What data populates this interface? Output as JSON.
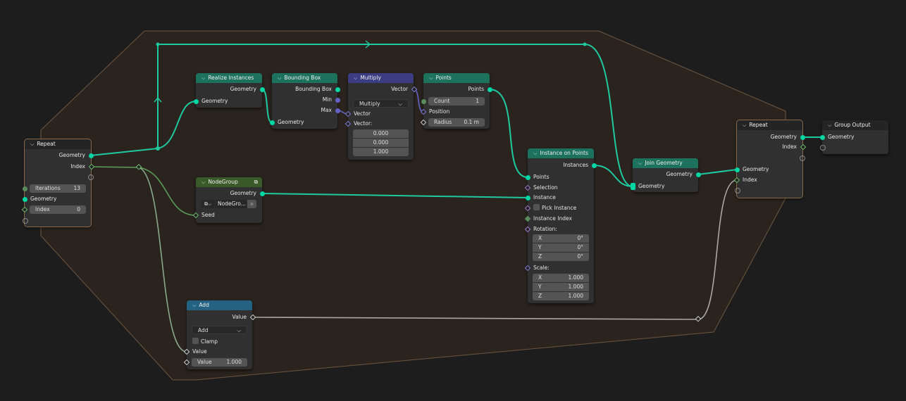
{
  "colors": {
    "background": "#1d1d1d",
    "zone": "#2b241e",
    "geometry_link": "#00d6a3",
    "vector": "#6363c7",
    "geometry_header": "#1d725e",
    "vector_header": "#3c3c83",
    "group_header": "#3b5a2a",
    "math_header": "#246283"
  },
  "repeat_input": {
    "title": "Repeat",
    "out_geometry": "Geometry",
    "out_index": "Index",
    "iterations_label": "Iterations",
    "iterations_value": "13",
    "in_geometry": "Geometry",
    "index_label": "Index",
    "index_value": "0"
  },
  "realize": {
    "title": "Realize Instances",
    "out": "Geometry",
    "in": "Geometry"
  },
  "bbox": {
    "title": "Bounding Box",
    "out_bbox": "Bounding Box",
    "out_min": "Min",
    "out_max": "Max",
    "in": "Geometry"
  },
  "multiply": {
    "title": "Multiply",
    "out": "Vector",
    "operation": "Multiply",
    "in_a": "Vector",
    "in_b": "Vector:",
    "b_values": [
      "0.000",
      "0.000",
      "1.000"
    ]
  },
  "points": {
    "title": "Points",
    "out": "Points",
    "count_label": "Count",
    "count_value": "1",
    "position": "Position",
    "radius_label": "Radius",
    "radius_value": "0.1 m"
  },
  "nodegroup": {
    "title": "NodeGroup",
    "out": "Geometry",
    "group_name": "NodeGro...",
    "seed": "Seed"
  },
  "iop": {
    "title": "Instance on Points",
    "out": "Instances",
    "points": "Points",
    "selection": "Selection",
    "instance": "Instance",
    "pick_instance": "Pick Instance",
    "instance_index": "Instance Index",
    "rotation": "Rotation:",
    "rotation_values": [
      {
        "axis": "X",
        "value": "0°"
      },
      {
        "axis": "Y",
        "value": "0°"
      },
      {
        "axis": "Z",
        "value": "0°"
      }
    ],
    "scale": "Scale:",
    "scale_values": [
      {
        "axis": "X",
        "value": "1.000"
      },
      {
        "axis": "Y",
        "value": "1.000"
      },
      {
        "axis": "Z",
        "value": "1.000"
      }
    ]
  },
  "join": {
    "title": "Join Geometry",
    "out": "Geometry",
    "in": "Geometry"
  },
  "repeat_output": {
    "title": "Repeat",
    "out_geometry": "Geometry",
    "out_index": "Index",
    "in_geometry": "Geometry",
    "in_index": "Index"
  },
  "group_output": {
    "title": "Group Output",
    "in": "Geometry"
  },
  "add": {
    "title": "Add",
    "out": "Value",
    "operation": "Add",
    "clamp": "Clamp",
    "in_a": "Value",
    "b_label": "Value",
    "b_value": "1.000"
  }
}
